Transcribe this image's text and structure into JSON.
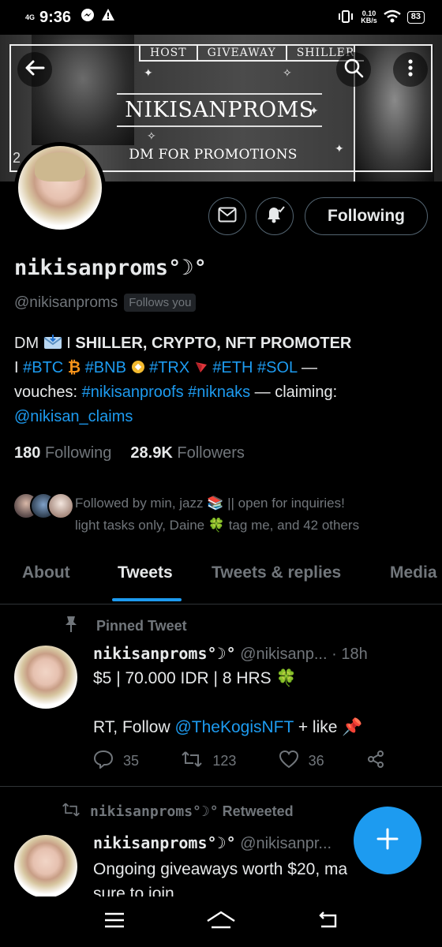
{
  "status_bar": {
    "network": "4G",
    "time": "9:36",
    "net_speed_value": "0.10",
    "net_speed_unit": "KB/s",
    "battery": "83"
  },
  "banner": {
    "tabs": [
      "HOST",
      "GIVEAWAY",
      "SHILLER"
    ],
    "title": "NIKISANPROMS",
    "subtitle": "DM FOR PROMOTIONS",
    "side_number": "2"
  },
  "profile": {
    "display_name": "nikisanproms°☽°",
    "handle": "@nikisanproms",
    "follows_you": "Follows you",
    "following_button": "Following",
    "bio": {
      "dm": "DM",
      "sep": "I",
      "bold": "SHILLER, CRYPTO, NFT PROMOTER",
      "line2_sep": "I",
      "tags": [
        "#BTC",
        "#BNB",
        "#TRX",
        "#ETH",
        "#SOL"
      ],
      "dash1": "—",
      "vouches_label": "vouches:",
      "proof_tags": [
        "#nikisanproofs",
        "#niknaks"
      ],
      "dash2": "— claiming:",
      "claim_handle": "@nikisan_claims"
    },
    "stats": {
      "following_count": "180",
      "following_label": "Following",
      "followers_count": "28.9K",
      "followers_label": "Followers"
    },
    "followed_by": {
      "line1": "Followed by min, jazz 📚 || open for inquiries!",
      "line2": "light tasks only, Daine 🍀 tag me, and 42 others"
    }
  },
  "tabs": [
    "About",
    "Tweets",
    "Tweets & replies",
    "Media"
  ],
  "active_tab": "Tweets",
  "tweets": [
    {
      "context": "Pinned Tweet",
      "name": "nikisanproms°☽°",
      "handle": "@nikisanp...",
      "time": "· 18h",
      "line1": "$5 | 70.000 IDR | 8 HRS 🍀",
      "line2_prefix": "RT, Follow",
      "line2_mention": "@TheKogisNFT",
      "line2_suffix": "+ like 📌",
      "replies": "35",
      "retweets": "123",
      "likes": "36"
    },
    {
      "context_name": "nikisanproms°☽°",
      "context": "Retweeted",
      "name": "nikisanproms°☽°",
      "handle": "@nikisanpr...",
      "line1": "Ongoing giveaways worth $20, ma",
      "line2": "sure to join"
    }
  ],
  "colors": {
    "accent": "#1d9bf0",
    "background": "#000000",
    "text_primary": "#e7e9ea",
    "text_secondary": "#71767b",
    "border": "#2f3336"
  },
  "icons": [
    "back-arrow-icon",
    "search-icon",
    "more-vertical-icon",
    "mail-icon",
    "bell-icon",
    "pin-icon",
    "reply-icon",
    "retweet-icon",
    "like-icon",
    "share-icon",
    "compose-plus-icon",
    "menu-icon",
    "home-icon",
    "back-icon"
  ]
}
